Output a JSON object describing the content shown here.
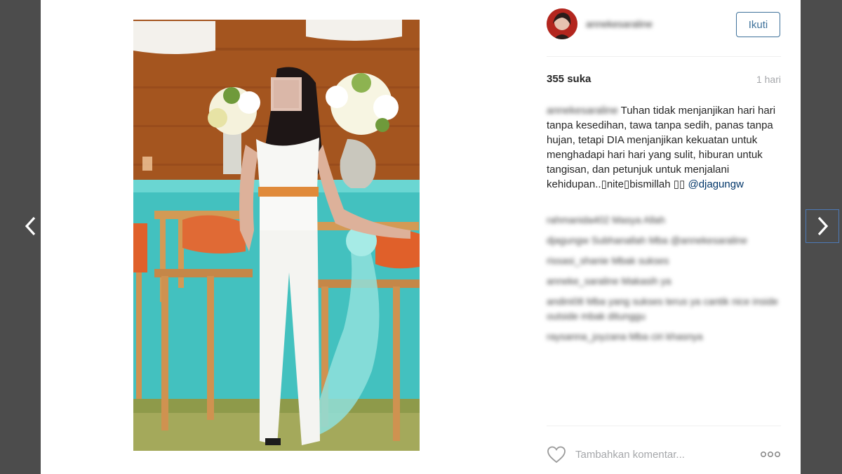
{
  "post": {
    "username": "annekesaraline",
    "follow_label": "Ikuti",
    "likes": "355 suka",
    "time": "1 hari",
    "caption": {
      "username": "annekesaraline",
      "text": "Tuhan tidak menjanjikan hari hari tanpa kesedihan, tawa tanpa sedih, panas tanpa hujan, tetapi DIA menjanjikan kekuatan untuk menghadapi hari hari yang sulit, hiburan untuk tangisan, dan petunjuk untuk menjalani kehidupan..▯nite▯bismillah ▯▯",
      "mention": "@djagungw"
    },
    "comments": [
      "rahmanida402 Masya Allah",
      "djagungw Subhanallah Mba @annekesaraline",
      "rissasi_shanie Mbak sukses",
      "anneke_saraline Makasih ya",
      "andini08 Mba yang sukses terus ya cantik nice inside outside mbak ditunggu",
      "raysanna_joyzana Mba ciri khasnya"
    ],
    "comment_placeholder": "Tambahkan komentar..."
  },
  "icons": {
    "prev": "chevron-left-icon",
    "next": "chevron-right-icon",
    "like": "heart-icon",
    "more": "ellipsis-icon"
  },
  "colors": {
    "backdrop": "#4c4c4c",
    "accent": "#3f729b",
    "mention": "#003569",
    "muted": "#a5a7aa"
  }
}
